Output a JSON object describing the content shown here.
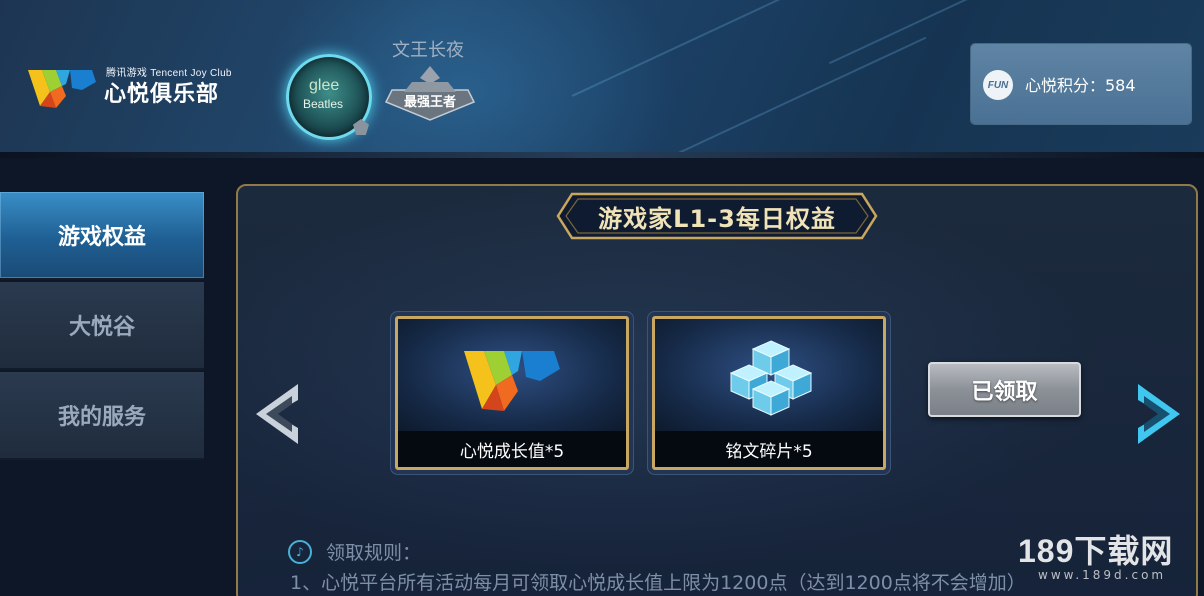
{
  "header": {
    "logo_sub": "腾讯游戏 Tencent Joy Club",
    "logo_main": "心悦俱乐部",
    "avatar_line1": "glee",
    "avatar_line2": "Beatles",
    "username": "文王长夜",
    "rank_emblem_text": "最强王者",
    "points": {
      "icon_text": "FUN",
      "label": "心悦积分：584"
    }
  },
  "sidebar": {
    "items": [
      {
        "label": "游戏权益",
        "active": true
      },
      {
        "label": "大悦谷",
        "active": false
      },
      {
        "label": "我的服务",
        "active": false
      }
    ]
  },
  "main": {
    "title": "游戏家L1-3每日权益",
    "rewards": [
      {
        "label": "心悦成长值*5",
        "icon": "vip-logo-icon"
      },
      {
        "label": "铭文碎片*5",
        "icon": "crystal-cubes-icon"
      }
    ],
    "claim_button": "已领取",
    "rules_title": "领取规则：",
    "rules_line1": "1、心悦平台所有活动每月可领取心悦成长值上限为1200点（达到1200点将不会增加）"
  },
  "watermark": {
    "main": "189下载网",
    "sub": "www.189d.com"
  },
  "colors": {
    "gold_border": "#c8a760",
    "active_tab": "#2f7fb8",
    "accent_cyan": "#4fd2f0"
  }
}
